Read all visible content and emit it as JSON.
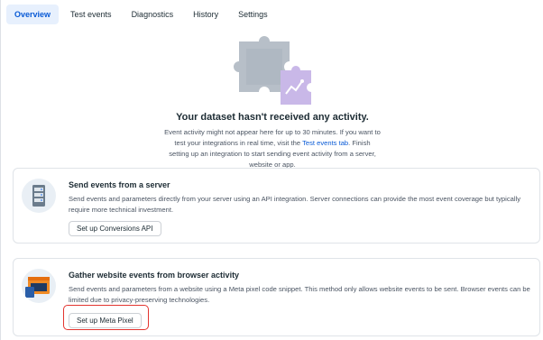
{
  "tabs": [
    {
      "label": "Overview",
      "active": true
    },
    {
      "label": "Test events",
      "active": false
    },
    {
      "label": "Diagnostics",
      "active": false
    },
    {
      "label": "History",
      "active": false
    },
    {
      "label": "Settings",
      "active": false
    }
  ],
  "hero": {
    "illustration_icon": "puzzle-illustration",
    "title": "Your dataset hasn't received any activity.",
    "desc_before_link": "Event activity might not appear here for up to 30 minutes. If you want to test your integrations in real time, visit the ",
    "link_text": "Test events tab",
    "desc_after_link": ". Finish setting up an integration to start sending event activity from a server, website or app."
  },
  "cards": [
    {
      "icon": "server-icon",
      "title": "Send events from a server",
      "desc": "Send events and parameters directly from your server using an API integration. Server connections can provide the most event coverage but typically require more technical investment.",
      "button": "Set up Conversions API"
    },
    {
      "icon": "browser-window-icon",
      "title": "Gather website events from browser activity",
      "desc": "Send events and parameters from a website using a Meta pixel code snippet. This method only allows website events to be sent. Browser events can be limited due to privacy-preserving technologies.",
      "button": "Set up Meta Pixel"
    }
  ],
  "colors": {
    "accent": "#0a5bd6",
    "highlight": "#e3342f"
  }
}
